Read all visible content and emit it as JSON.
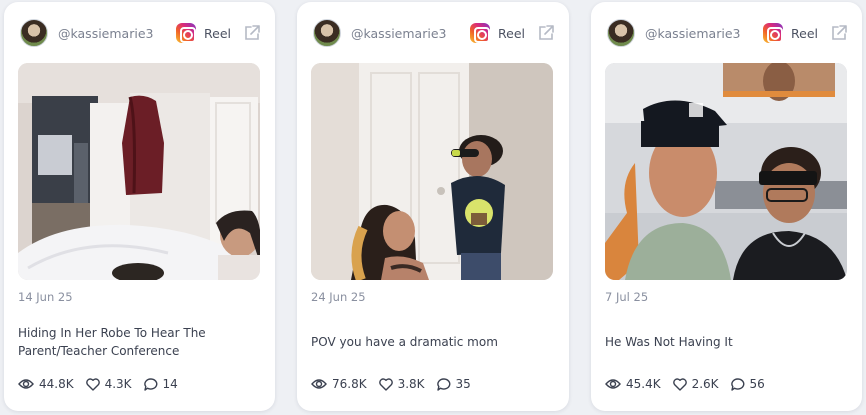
{
  "cards": [
    {
      "username": "@kassiemarie3",
      "type": "Reel",
      "date": "14 Jun 25",
      "caption": "Hiding In Her Robe To Hear The Parent/Teacher Conference",
      "views": "44.8K",
      "likes": "4.3K",
      "comments": "14"
    },
    {
      "username": "@kassiemarie3",
      "type": "Reel",
      "date": "24 Jun 25",
      "caption": "POV you have a dramatic mom",
      "views": "76.8K",
      "likes": "3.8K",
      "comments": "35"
    },
    {
      "username": "@kassiemarie3",
      "type": "Reel",
      "date": "7 Jul 25",
      "caption": "He Was Not Having It",
      "views": "45.4K",
      "likes": "2.6K",
      "comments": "56"
    }
  ],
  "colors": {
    "page_background": "#eef0f4",
    "card_background": "#ffffff",
    "muted_text": "#7b8190",
    "body_text": "#3b4150"
  }
}
